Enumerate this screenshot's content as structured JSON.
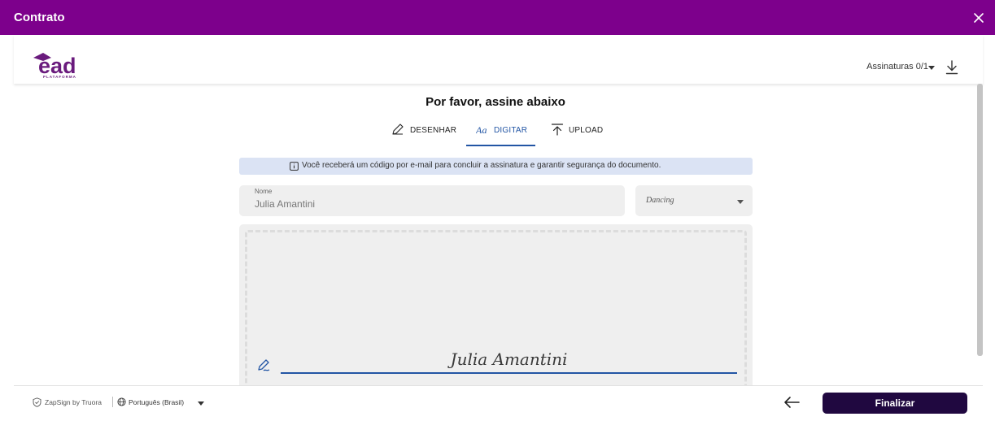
{
  "header": {
    "title": "Contrato"
  },
  "document_bar": {
    "logo_text": "ead",
    "logo_subtext": "PLATAFORMA",
    "signatures_label": "Assinaturas 0/1"
  },
  "main": {
    "title": "Por favor, assine abaixo",
    "tabs": [
      {
        "label": "DESENHAR",
        "icon": "pen-icon",
        "active": false
      },
      {
        "label": "DIGITAR",
        "icon": "text-icon",
        "active": true
      },
      {
        "label": "UPLOAD",
        "icon": "upload-icon",
        "active": false
      }
    ],
    "info": "Você receberá um código por e-mail para concluir a assinatura e garantir segurança do documento.",
    "name_field": {
      "label": "Nome",
      "value": "Julia Amantini"
    },
    "font_select": {
      "value": "Dancing"
    },
    "signature_preview": "Julia Amantini"
  },
  "footer": {
    "brand": "ZapSign by Truora",
    "language": "Português (Brasil)",
    "finalize_label": "Finalizar"
  },
  "colors": {
    "header": "#7d008c",
    "accent": "#2255a4",
    "button": "#200840",
    "logo": "#6a1b7d"
  }
}
